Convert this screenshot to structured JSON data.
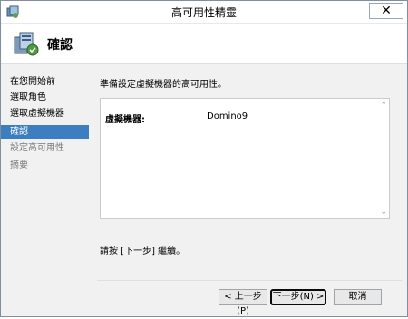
{
  "window": {
    "title": "高可用性精靈"
  },
  "titlebar": {
    "close_glyph": "✕"
  },
  "header": {
    "title": "確認"
  },
  "nav": {
    "items": [
      {
        "label": "在您開始前",
        "state": "normal"
      },
      {
        "label": "選取角色",
        "state": "normal"
      },
      {
        "label": "選取虛擬機器",
        "state": "normal"
      },
      {
        "label": "確認",
        "state": "active"
      },
      {
        "label": "設定高可用性",
        "state": "disabled"
      },
      {
        "label": "摘要",
        "state": "disabled"
      }
    ]
  },
  "main": {
    "intro": "準備設定虛擬機器的高可用性。",
    "summary": {
      "label": "虛擬機器:",
      "value": "Domino9"
    },
    "hint": "請按 [下一步] 繼續。"
  },
  "buttons": {
    "prev": "< 上一步(P)",
    "next": "下一步(N) >",
    "cancel": "取消"
  },
  "colors": {
    "accent": "#3d7ec0",
    "content_bg": "#f1f1f1"
  }
}
